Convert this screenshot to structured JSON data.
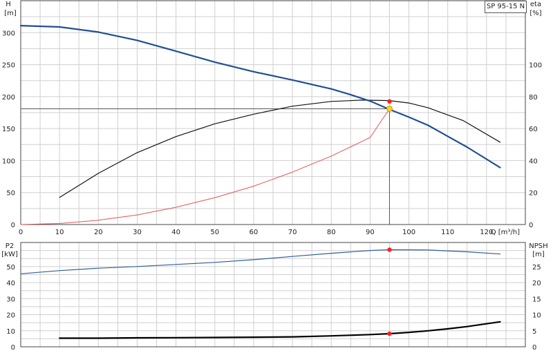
{
  "model": "SP 95-15 N",
  "colors": {
    "head_curve": "#1f4f93",
    "efficiency_curve": "#111111",
    "system_curve": "#e85050",
    "power_curve": "#2f5d9a",
    "npsh_curve": "#000000",
    "grid": "#cfcfcf",
    "duty_point": "#ff2020",
    "duty_point_highlight": "#ffd21a"
  },
  "chart_data": [
    {
      "type": "line",
      "panel": "top",
      "xlabel": "Q [m³/h]",
      "ylabel_left": "H [m]",
      "ylabel_right": "eta [%]",
      "x_ticks": [
        0,
        10,
        20,
        30,
        40,
        50,
        60,
        70,
        80,
        90,
        100,
        110,
        120
      ],
      "y_left_ticks": [
        0,
        50,
        100,
        150,
        200,
        250,
        300
      ],
      "y_right_ticks": [
        0,
        20,
        40,
        60,
        80,
        100
      ],
      "xlim": [
        0,
        130
      ],
      "ylim_left": [
        0,
        350
      ],
      "ylim_right": [
        0,
        140
      ],
      "grid": true,
      "series": [
        {
          "key": "head",
          "axis": "left",
          "x": [
            0,
            10,
            20,
            30,
            40,
            50,
            60,
            70,
            80,
            85,
            90,
            95,
            100,
            105,
            110,
            115,
            123.5
          ],
          "y": [
            311,
            309,
            301,
            288,
            271,
            254,
            239,
            226,
            212,
            203,
            193,
            180,
            168,
            155,
            138,
            121,
            89
          ]
        },
        {
          "key": "efficiency",
          "axis": "right",
          "x": [
            10,
            20,
            30,
            40,
            50,
            60,
            70,
            80,
            88,
            95,
            100,
            105,
            114,
            123.5
          ],
          "y": [
            17,
            32,
            45,
            55,
            63,
            69,
            74,
            77,
            77.8,
            77.5,
            76,
            73,
            65,
            51.5
          ]
        },
        {
          "key": "system_curve",
          "axis": "left",
          "x": [
            0,
            10,
            20,
            30,
            40,
            50,
            60,
            70,
            80,
            90,
            95
          ],
          "y": [
            0,
            1.6,
            6.7,
            15,
            27,
            42,
            60,
            82,
            107,
            136,
            181
          ]
        }
      ],
      "duty_point": {
        "q": 95,
        "h": 181,
        "eta": 77
      },
      "reference_lines": {
        "h": 181,
        "q": 95
      }
    },
    {
      "type": "line",
      "panel": "bottom",
      "ylabel_left": "P2 [kW]",
      "ylabel_right": "NPSH [m]",
      "y_left_ticks": [
        0,
        10,
        20,
        30,
        40,
        50
      ],
      "y_right_ticks": [
        0,
        5,
        10,
        15,
        20,
        25
      ],
      "xlim": [
        0,
        130
      ],
      "ylim_left": [
        0,
        65
      ],
      "ylim_right": [
        0,
        32.5
      ],
      "grid": true,
      "series": [
        {
          "key": "p2",
          "axis": "left",
          "x": [
            0,
            10,
            20,
            30,
            40,
            50,
            60,
            70,
            80,
            90,
            95,
            105,
            115,
            123.5
          ],
          "y": [
            45.5,
            47.5,
            49,
            50,
            51.3,
            52.6,
            54.3,
            56.3,
            58.3,
            60,
            60.5,
            60.3,
            59.2,
            57.8
          ]
        },
        {
          "key": "npsh",
          "axis": "right",
          "x": [
            10,
            20,
            30,
            40,
            50,
            60,
            70,
            80,
            90,
            95,
            100,
            105,
            110,
            115,
            123.5
          ],
          "y": [
            2.7,
            2.7,
            2.8,
            2.85,
            2.9,
            3.0,
            3.1,
            3.4,
            3.8,
            4.1,
            4.5,
            5.0,
            5.6,
            6.3,
            7.8
          ]
        }
      ],
      "duty_point": {
        "q": 95,
        "p2": 60.5,
        "npsh": 4.1
      }
    }
  ]
}
